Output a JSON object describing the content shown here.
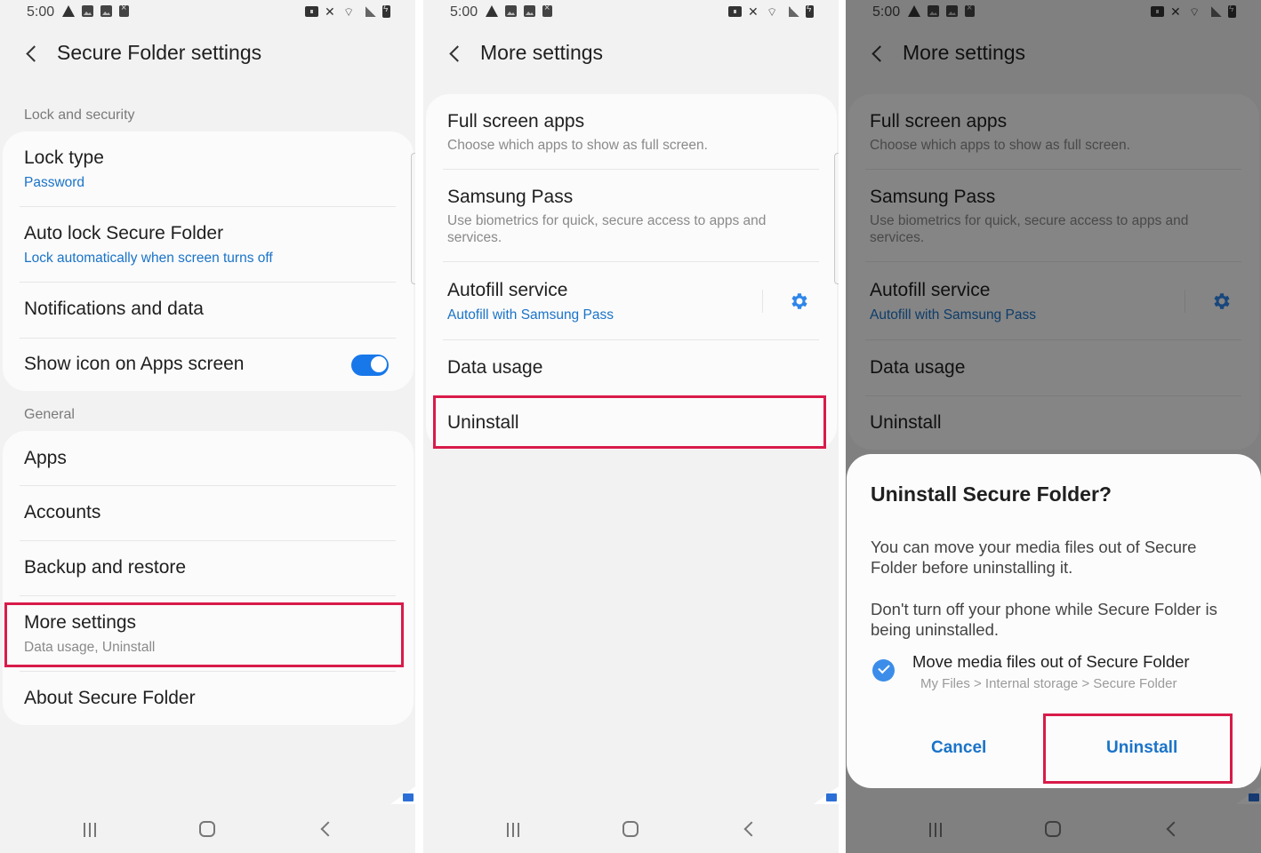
{
  "status_bar": {
    "time": "5:00",
    "left_icons": [
      "warning-icon",
      "image-icon",
      "image-icon",
      "file-x-icon"
    ],
    "right_icons": [
      "secure-folder-icon",
      "mute-icon",
      "wifi-icon",
      "signal-icon",
      "battery-charging-icon"
    ]
  },
  "screens": [
    {
      "header": {
        "title": "Secure Folder settings"
      },
      "sections": [
        {
          "label": "Lock and security",
          "items": [
            {
              "title": "Lock type",
              "subtitle": "Password"
            },
            {
              "title": "Auto lock Secure Folder",
              "subtitle": "Lock automatically when screen turns off"
            },
            {
              "title": "Notifications and data"
            },
            {
              "title": "Show icon on Apps screen",
              "toggle_on": true
            }
          ]
        },
        {
          "label": "General",
          "items": [
            {
              "title": "Apps"
            },
            {
              "title": "Accounts"
            },
            {
              "title": "Backup and restore"
            },
            {
              "title": "More settings",
              "subtitle": "Data usage, Uninstall",
              "highlighted": true
            },
            {
              "title": "About Secure Folder"
            }
          ]
        }
      ]
    },
    {
      "header": {
        "title": "More settings"
      },
      "items": [
        {
          "title": "Full screen apps",
          "subtitle": "Choose which apps to show as full screen."
        },
        {
          "title": "Samsung Pass",
          "subtitle_line1": "Use biometrics for quick, secure access to apps and",
          "subtitle_line2": "services."
        },
        {
          "title": "Autofill service",
          "subtitle": "Autofill with Samsung Pass",
          "action_icon": "gear-icon"
        },
        {
          "title": "Data usage"
        },
        {
          "title": "Uninstall",
          "highlighted": true
        }
      ]
    },
    {
      "header": {
        "title": "More settings"
      },
      "dialog": {
        "title": "Uninstall Secure Folder?",
        "body1_line1": "You can move your media files out of Secure",
        "body1_line2": "Folder before uninstalling it.",
        "body2_line1": "Don't turn off your phone while Secure Folder is",
        "body2_line2": "being uninstalled.",
        "checkbox": {
          "label": "Move media files out of Secure Folder",
          "sublabel": "My Files > Internal storage > Secure Folder",
          "checked": true
        },
        "cancel_label": "Cancel",
        "confirm_label": "Uninstall",
        "confirm_highlighted": true
      }
    }
  ],
  "colors": {
    "accent_blue": "#1a73c8",
    "toggle_blue": "#1878ea",
    "highlight_red": "#d81b4a",
    "background": "#f2f2f2"
  }
}
